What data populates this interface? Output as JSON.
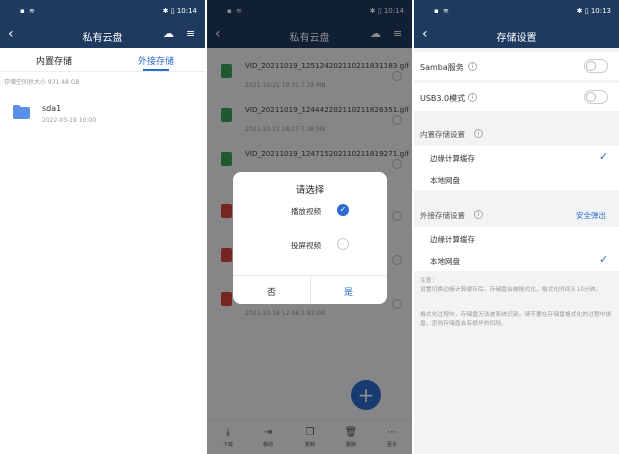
{
  "panel1": {
    "status": {
      "left": "▪ ≋",
      "right": "✱ ▯ 10:14"
    },
    "title": "私有云盘",
    "tabs": [
      "内置存储",
      "外接存储"
    ],
    "capacity": "存储空间总大小 931.48 GB",
    "folder": {
      "name": "sda1",
      "date": "2022-03-19 10:00"
    }
  },
  "panel2": {
    "status": {
      "left": "▪ ≋",
      "right": "✱ ▯ 10:14"
    },
    "title": "私有云盘",
    "files": [
      {
        "name": "VID_20211019_125124202110211831183.gif",
        "meta": "2021-10-21 18:31    7.22 MB",
        "color": "#3aa356"
      },
      {
        "name": "VID_20211019_124442202110211826351.gif",
        "meta": "2021-10-21 18:27    7.38 MB",
        "color": "#3aa356"
      },
      {
        "name": "VID_20211019_124715202110211819271.gif",
        "meta": "",
        "color": "#3aa356"
      },
      {
        "name": "",
        "meta": "",
        "color": "#d64541"
      },
      {
        "name": "",
        "meta": "",
        "color": "#d64541"
      },
      {
        "name": "",
        "meta": "2021-10-18 12:48    2.83 GB",
        "color": "#d64541"
      }
    ],
    "dialog": {
      "title": "请选择",
      "option1": "播放视频",
      "option2": "投屏视频",
      "no": "否",
      "yes": "是"
    },
    "bottom_bar": [
      {
        "icon": "⤓",
        "label": "下载"
      },
      {
        "icon": "⇥",
        "label": "移动"
      },
      {
        "icon": "❐",
        "label": "复制"
      },
      {
        "icon": "🗑",
        "label": "删除"
      },
      {
        "icon": "⋯",
        "label": "更多"
      }
    ]
  },
  "panel3": {
    "status": {
      "left": "▪ ≋",
      "right": "✱ ▯ 10:13"
    },
    "title": "存储设置",
    "samba": "Samba服务",
    "usb": "USB3.0模式",
    "internal_section": "内置存储设置",
    "internal_options": [
      "边缘计算缓存",
      "本地网盘"
    ],
    "external_section": "外接存储设置",
    "safe_eject": "安全弹出",
    "external_options": [
      "边缘计算缓存",
      "本地网盘"
    ],
    "note_title": "注意：",
    "note1": "设置切换边缘计算缓存后，存储盘会被格式化，格式化时间3-10分钟。",
    "note2": "格式化过程中，存储盘无法被系统识别，请不要在存储盘格式化的过程中拔盘，否则存储盘会有损坏的风险。"
  },
  "colors": {
    "bar": "#1e3a5f",
    "accent": "#2c6cd0"
  }
}
